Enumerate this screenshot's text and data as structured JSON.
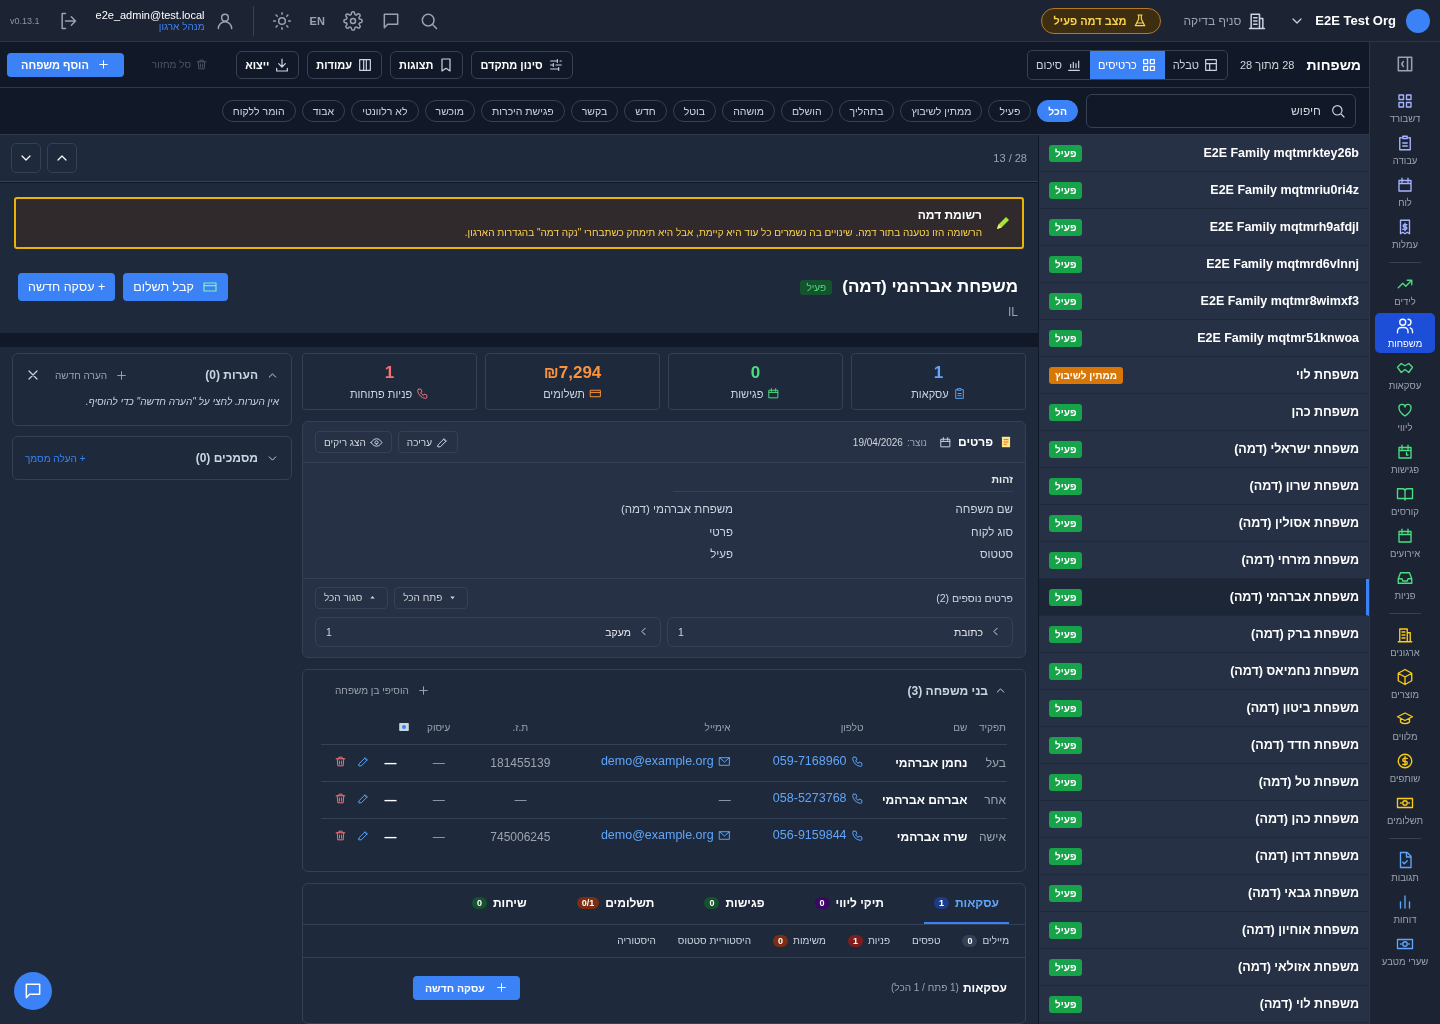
{
  "topbar": {
    "org_name": "E2E Test Org",
    "branch": "סניף בדיקה",
    "demo_badge": "מצב דמה פעיל",
    "language": "EN",
    "user_email": "e2e_admin@test.local",
    "user_role": "מנהל ארגון",
    "version": "v0.13.1"
  },
  "sidebar": {
    "sections": [
      [
        {
          "label": "דשבורד",
          "selected": false
        },
        {
          "label": "עבודה",
          "selected": false
        },
        {
          "label": "לוח",
          "selected": false
        },
        {
          "label": "עמלות",
          "selected": false
        }
      ],
      [
        {
          "label": "לידים",
          "selected": false
        },
        {
          "label": "משפחות",
          "selected": true
        },
        {
          "label": "עסקאות",
          "selected": false
        },
        {
          "label": "ליווי",
          "selected": false
        },
        {
          "label": "פגישות",
          "selected": false
        },
        {
          "label": "קורסים",
          "selected": false
        },
        {
          "label": "אירועים",
          "selected": false
        },
        {
          "label": "פניות",
          "selected": false
        }
      ],
      [
        {
          "label": "ארגונים",
          "selected": false
        },
        {
          "label": "מוצרים",
          "selected": false
        },
        {
          "label": "מלווים",
          "selected": false
        },
        {
          "label": "שותפים",
          "selected": false
        },
        {
          "label": "תשלומים",
          "selected": false
        }
      ],
      [
        {
          "label": "תגובות",
          "selected": false
        },
        {
          "label": "דוחות",
          "selected": false
        },
        {
          "label": "שערי מטבע",
          "selected": false
        }
      ]
    ]
  },
  "toolbar": {
    "title": "משפחות",
    "count": "28 מתוך 28",
    "views": [
      {
        "label": "טבלה",
        "selected": false
      },
      {
        "label": "כרטיסים",
        "selected": true
      },
      {
        "label": "סיכום",
        "selected": false
      }
    ],
    "buttons": [
      "סינון מתקדם",
      "תצוגות",
      "עמודות",
      "ייצוא"
    ],
    "recycle": "סל מחזור",
    "add": "הוסף משפחה"
  },
  "filters": {
    "search": {
      "placeholder": "חיפוש"
    },
    "chips": [
      {
        "label": "הכל",
        "selected": true
      },
      {
        "label": "פעיל",
        "selected": false
      },
      {
        "label": "ממתין לשיבוץ",
        "selected": false
      },
      {
        "label": "בתהליך",
        "selected": false
      },
      {
        "label": "הושלם",
        "selected": false
      },
      {
        "label": "מושהה",
        "selected": false
      },
      {
        "label": "בוטל",
        "selected": false
      },
      {
        "label": "חדש",
        "selected": false
      },
      {
        "label": "בקשר",
        "selected": false
      },
      {
        "label": "פגישת היכרות",
        "selected": false
      },
      {
        "label": "מוכשר",
        "selected": false
      },
      {
        "label": "לא רלוונטי",
        "selected": false
      },
      {
        "label": "אבוד",
        "selected": false
      },
      {
        "label": "הומר ללקוח",
        "selected": false
      }
    ]
  },
  "list": [
    {
      "name": "E2E Family mqtmrktey26b",
      "status": "פעיל",
      "color": "#16a34a",
      "selected": false
    },
    {
      "name": "E2E Family mqtmriu0ri4z",
      "status": "פעיל",
      "color": "#16a34a",
      "selected": false
    },
    {
      "name": "E2E Family mqtmrh9afdjl",
      "status": "פעיל",
      "color": "#16a34a",
      "selected": false
    },
    {
      "name": "E2E Family mqtmrd6vlnnj",
      "status": "פעיל",
      "color": "#16a34a",
      "selected": false
    },
    {
      "name": "E2E Family mqtmr8wimxf3",
      "status": "פעיל",
      "color": "#16a34a",
      "selected": false
    },
    {
      "name": "E2E Family mqtmr51knwoa",
      "status": "פעיל",
      "color": "#16a34a",
      "selected": false
    },
    {
      "name": "משפחת לוי",
      "status": "ממתין לשיבוץ",
      "color": "#d97706",
      "selected": false
    },
    {
      "name": "משפחת כהן",
      "status": "פעיל",
      "color": "#16a34a",
      "selected": false
    },
    {
      "name": "משפחת ישראלי (דמה)",
      "status": "פעיל",
      "color": "#16a34a",
      "selected": false
    },
    {
      "name": "משפחת שרון (דמה)",
      "status": "פעיל",
      "color": "#16a34a",
      "selected": false
    },
    {
      "name": "משפחת אסולין (דמה)",
      "status": "פעיל",
      "color": "#16a34a",
      "selected": false
    },
    {
      "name": "משפחת מזרחי (דמה)",
      "status": "פעיל",
      "color": "#16a34a",
      "selected": false
    },
    {
      "name": "משפחת אברהמי (דמה)",
      "status": "פעיל",
      "color": "#16a34a",
      "selected": true
    },
    {
      "name": "משפחת ברק (דמה)",
      "status": "פעיל",
      "color": "#16a34a",
      "selected": false
    },
    {
      "name": "משפחת נחמיאס (דמה)",
      "status": "פעיל",
      "color": "#16a34a",
      "selected": false
    },
    {
      "name": "משפחת ביטון (דמה)",
      "status": "פעיל",
      "color": "#16a34a",
      "selected": false
    },
    {
      "name": "משפחת חדד (דמה)",
      "status": "פעיל",
      "color": "#16a34a",
      "selected": false
    },
    {
      "name": "משפחת טל (דמה)",
      "status": "פעיל",
      "color": "#16a34a",
      "selected": false
    },
    {
      "name": "משפחת כהן (דמה)",
      "status": "פעיל",
      "color": "#16a34a",
      "selected": false
    },
    {
      "name": "משפחת דהן (דמה)",
      "status": "פעיל",
      "color": "#16a34a",
      "selected": false
    },
    {
      "name": "משפחת גבאי (דמה)",
      "status": "פעיל",
      "color": "#16a34a",
      "selected": false
    },
    {
      "name": "משפחת אוחיון (דמה)",
      "status": "פעיל",
      "color": "#16a34a",
      "selected": false
    },
    {
      "name": "משפחת אזולאי (דמה)",
      "status": "פעיל",
      "color": "#16a34a",
      "selected": false
    },
    {
      "name": "משפחת לוי (דמה)",
      "status": "פעיל",
      "color": "#16a34a",
      "selected": false
    }
  ],
  "detail": {
    "position": "28 / 13",
    "banner": {
      "title": "רשומת דמה",
      "text": "הרשומה הזו נטענה בתור דמה. שינויים בה נשמרים כל עוד היא קיימת, אבל היא תימחק כשתבחרי \"נקה דמה\" בהגדרות הארגון."
    },
    "name": "משפחת אברהמי (דמה)",
    "status": "פעיל",
    "country": "IL",
    "pay_button": "קבל תשלום",
    "deal_button": "+ עסקה חדשה",
    "stats": [
      {
        "value": "1",
        "label": "עסקאות",
        "color": "#60a5fa"
      },
      {
        "value": "0",
        "label": "פגישות",
        "color": "#4ade80"
      },
      {
        "value": "₪7,294",
        "label": "תשלומים",
        "color": "#fb923c"
      },
      {
        "value": "1",
        "label": "פניות פתוחות",
        "color": "#f87171"
      }
    ],
    "details": {
      "title": "פרטים",
      "created_label": "נוצר:",
      "created": "19/04/2026",
      "edit": "עריכה",
      "show_empty": "הצג ריקים",
      "section": "זהות",
      "fields": [
        {
          "label": "שם משפחה",
          "value": "משפחת אברהמי (דמה)"
        },
        {
          "label": "סוג לקוח",
          "value": "פרטי"
        },
        {
          "label": "סטטוס",
          "value": "פעיל"
        }
      ],
      "extra_title": "פרטים נוספים (2)",
      "expand_all": "פתח הכל",
      "collapse_all": "סגור הכל",
      "groups": [
        {
          "label": "כתובת",
          "count": "1"
        },
        {
          "label": "מעקב",
          "count": "1"
        }
      ]
    },
    "members": {
      "title": "בני משפחה (3)",
      "add": "הוסיפי בן משפחה",
      "columns": [
        "תפקיד",
        "שם",
        "טלפון",
        "אימייל",
        "ת.ז.",
        "עיסוק"
      ],
      "rows": [
        {
          "role": "בעל",
          "name": "נחמן אברהמי",
          "phone": "059-7168960",
          "email": "demo@example.org",
          "id_number": "181455139",
          "occupation": "—",
          "flag": "—"
        },
        {
          "role": "אחר",
          "name": "אברהם אברהמי",
          "phone": "058-5273768",
          "email": "—",
          "id_number": "—",
          "occupation": "—",
          "flag": "—"
        },
        {
          "role": "אישה",
          "name": "שרה אברהמי",
          "phone": "056-9159844",
          "email": "demo@example.org",
          "id_number": "745006245",
          "occupation": "—",
          "flag": "—"
        }
      ]
    },
    "tabs": [
      {
        "label": "עסקאות",
        "count": "1",
        "color": "#1e3a8a",
        "selected": true
      },
      {
        "label": "תיקי ליווי",
        "count": "0",
        "color": "#3b0764",
        "selected": false
      },
      {
        "label": "פגישות",
        "count": "0",
        "color": "#14532d",
        "selected": false
      },
      {
        "label": "תשלומים",
        "count": "0/1",
        "color": "#7c2d12",
        "selected": false
      },
      {
        "label": "שיחות",
        "count": "0",
        "color": "#14532d",
        "selected": false
      }
    ],
    "subtabs": [
      {
        "label": "מיילים",
        "count": "0",
        "color": "#334155"
      },
      {
        "label": "טפסים"
      },
      {
        "label": "פניות",
        "count": "1",
        "color": "#7f1d1d"
      },
      {
        "label": "משימות",
        "count": "0",
        "color": "#7c2d12"
      },
      {
        "label": "היסטוריית סטטוס"
      },
      {
        "label": "היסטוריה"
      }
    ],
    "deals": {
      "title": "עסקאות",
      "meta": "(1 פתח / 1 הכל)",
      "button": "עסקה חדשה"
    }
  },
  "notes": {
    "title": "הערות (0)",
    "add": "הערה חדשה",
    "empty": "אין הערות. לחצי על \"הערה חדשה\" כדי להוסיף."
  },
  "documents": {
    "title": "מסמכים (0)",
    "add": "+ העלה מסמך"
  }
}
